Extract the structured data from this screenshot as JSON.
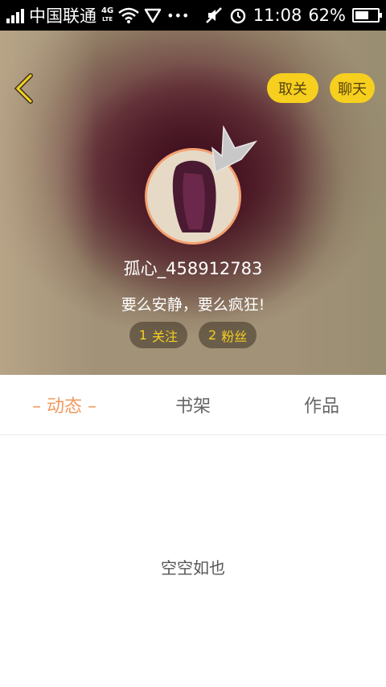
{
  "status_bar": {
    "carrier": "中国联通",
    "network_type": "4G",
    "network_sub": "LTE",
    "more": "•••",
    "time": "11:08",
    "battery": "62%",
    "battery_level": 0.62
  },
  "header": {
    "unfollow_label": "取关",
    "chat_label": "聊天",
    "username": "孤心_458912783",
    "signature": "要么安静，要么疯狂!",
    "following_count": "1",
    "following_label": "关注",
    "followers_count": "2",
    "followers_label": "粉丝"
  },
  "tabs": [
    {
      "label": "– 动态 –"
    },
    {
      "label": "书架"
    },
    {
      "label": "作品"
    }
  ],
  "empty_message": "空空如也",
  "colors": {
    "accent_yellow": "#f6cf1f",
    "active_tab": "#ef9a5f",
    "avatar_border": "#f3a070"
  }
}
